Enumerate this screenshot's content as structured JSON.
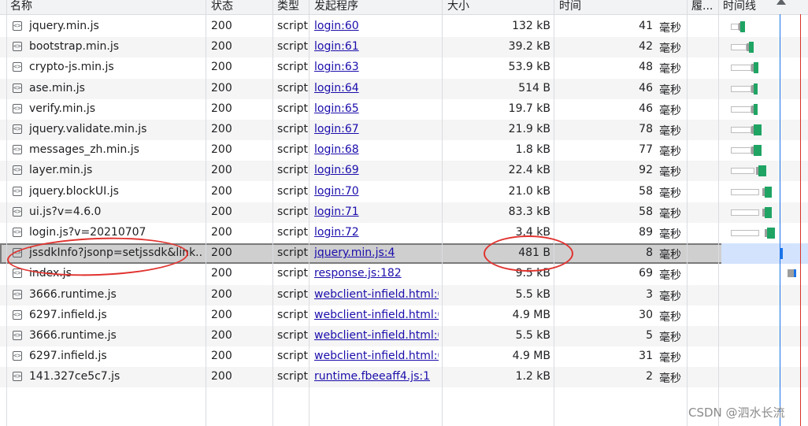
{
  "columns": {
    "name": "名称",
    "status": "状态",
    "type": "类型",
    "initiator": "发起程序",
    "size": "大小",
    "time": "时间",
    "waterfall_short": "履...",
    "timeline": "时间线"
  },
  "rows": [
    {
      "name": "jquery.min.js",
      "status": "200",
      "type": "script",
      "initiator": "login:60",
      "size": "132 kB",
      "time": "41",
      "unit": "毫秒"
    },
    {
      "name": "bootstrap.min.js",
      "status": "200",
      "type": "script",
      "initiator": "login:61",
      "size": "39.2 kB",
      "time": "42",
      "unit": "毫秒"
    },
    {
      "name": "crypto-js.min.js",
      "status": "200",
      "type": "script",
      "initiator": "login:63",
      "size": "53.9 kB",
      "time": "48",
      "unit": "毫秒"
    },
    {
      "name": "ase.min.js",
      "status": "200",
      "type": "script",
      "initiator": "login:64",
      "size": "514 B",
      "time": "46",
      "unit": "毫秒"
    },
    {
      "name": "verify.min.js",
      "status": "200",
      "type": "script",
      "initiator": "login:65",
      "size": "19.7 kB",
      "time": "46",
      "unit": "毫秒"
    },
    {
      "name": "jquery.validate.min.js",
      "status": "200",
      "type": "script",
      "initiator": "login:67",
      "size": "21.9 kB",
      "time": "78",
      "unit": "毫秒"
    },
    {
      "name": "messages_zh.min.js",
      "status": "200",
      "type": "script",
      "initiator": "login:68",
      "size": "1.8 kB",
      "time": "77",
      "unit": "毫秒"
    },
    {
      "name": "layer.min.js",
      "status": "200",
      "type": "script",
      "initiator": "login:69",
      "size": "22.4 kB",
      "time": "92",
      "unit": "毫秒"
    },
    {
      "name": "jquery.blockUI.js",
      "status": "200",
      "type": "script",
      "initiator": "login:70",
      "size": "21.0 kB",
      "time": "58",
      "unit": "毫秒"
    },
    {
      "name": "ui.js?v=4.6.0",
      "status": "200",
      "type": "script",
      "initiator": "login:71",
      "size": "83.3 kB",
      "time": "58",
      "unit": "毫秒"
    },
    {
      "name": "login.js?v=20210707",
      "status": "200",
      "type": "script",
      "initiator": "login:72",
      "size": "3.4 kB",
      "time": "89",
      "unit": "毫秒"
    },
    {
      "name": "jssdkInfo?jsonp=setjssdk&link...",
      "status": "200",
      "type": "script",
      "initiator": "jquery.min.js:4",
      "size": "481 B",
      "time": "8",
      "unit": "毫秒"
    },
    {
      "name": "index.js",
      "status": "200",
      "type": "script",
      "initiator": "response.js:182",
      "size": "9.5 kB",
      "time": "69",
      "unit": "毫秒"
    },
    {
      "name": "3666.runtime.js",
      "status": "200",
      "type": "script",
      "initiator": "webclient-infield.html:0",
      "size": "5.5 kB",
      "time": "3",
      "unit": "毫秒"
    },
    {
      "name": "6297.infield.js",
      "status": "200",
      "type": "script",
      "initiator": "webclient-infield.html:0",
      "size": "4.9 MB",
      "time": "30",
      "unit": "毫秒"
    },
    {
      "name": "3666.runtime.js",
      "status": "200",
      "type": "script",
      "initiator": "webclient-infield.html:0",
      "size": "5.5 kB",
      "time": "5",
      "unit": "毫秒"
    },
    {
      "name": "6297.infield.js",
      "status": "200",
      "type": "script",
      "initiator": "webclient-infield.html:0",
      "size": "4.9 MB",
      "time": "31",
      "unit": "毫秒"
    },
    {
      "name": "141.327ce5c7.js",
      "status": "200",
      "type": "script",
      "initiator": "runtime.fbeeaff4.js:1",
      "size": "1.2 kB",
      "time": "2",
      "unit": "毫秒"
    }
  ],
  "watermark": "CSDN @泗水长流",
  "colors": {
    "link": "#1a0dab",
    "annotation": "#e0332f",
    "waterfall_receive": "#1fa463",
    "timeline_marker": "#1a73e8"
  }
}
